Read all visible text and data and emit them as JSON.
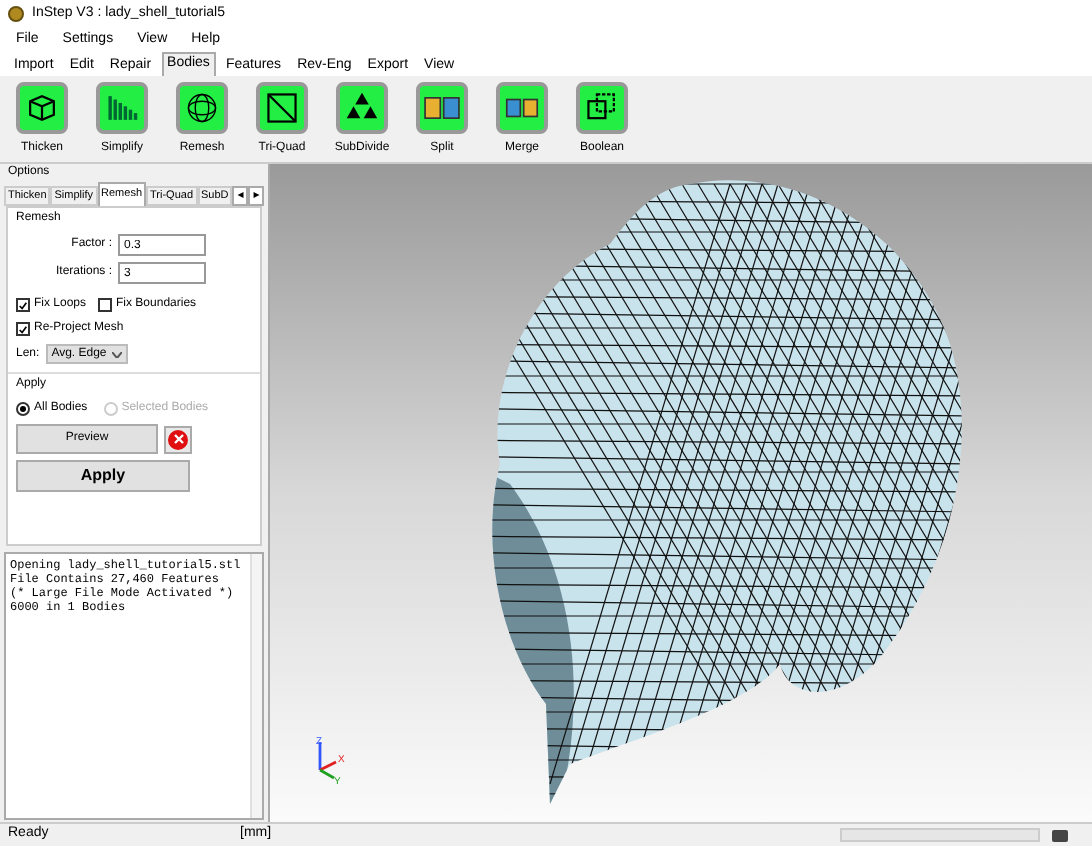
{
  "window": {
    "title": "InStep V3 : lady_shell_tutorial5"
  },
  "menu": [
    "File",
    "Settings",
    "View",
    "Help"
  ],
  "ribbon_tabs": [
    {
      "label": "Import",
      "selected": false
    },
    {
      "label": "Edit",
      "selected": false
    },
    {
      "label": "Repair",
      "selected": false
    },
    {
      "label": "Bodies",
      "selected": true
    },
    {
      "label": "Features",
      "selected": false
    },
    {
      "label": "Rev-Eng",
      "selected": false
    },
    {
      "label": "Export",
      "selected": false
    },
    {
      "label": "View",
      "selected": false
    }
  ],
  "tools": [
    {
      "label": "Thicken",
      "kind": "cube"
    },
    {
      "label": "Simplify",
      "kind": "bars"
    },
    {
      "label": "Remesh",
      "kind": "sphere"
    },
    {
      "label": "Tri-Quad",
      "kind": "square"
    },
    {
      "label": "SubDivide",
      "kind": "triangles"
    },
    {
      "label": "Split",
      "kind": "split"
    },
    {
      "label": "Merge",
      "kind": "merge"
    },
    {
      "label": "Boolean",
      "kind": "boolean"
    }
  ],
  "options": {
    "title": "Options",
    "tabs": [
      {
        "label": "Thicken",
        "selected": false
      },
      {
        "label": "Simplify",
        "selected": false
      },
      {
        "label": "Remesh",
        "selected": true
      },
      {
        "label": "Tri-Quad",
        "selected": false
      },
      {
        "label": "SubD",
        "selected": false
      }
    ],
    "scroll_left": "◂",
    "scroll_right": "▸",
    "remesh": {
      "title": "Remesh",
      "fields": [
        {
          "label": "Factor :",
          "value": "0.3"
        },
        {
          "label": "Iterations :",
          "value": "3"
        }
      ],
      "checkboxes": [
        {
          "label": "Fix Loops",
          "checked": true
        },
        {
          "label": "Fix Boundaries",
          "checked": false
        },
        {
          "label": "Re-Project Mesh",
          "checked": true
        }
      ],
      "len_label": "Len:",
      "len_value": "Avg. Edge"
    },
    "apply": {
      "title": "Apply",
      "radios": [
        {
          "label": "All Bodies",
          "selected": true,
          "disabled": false
        },
        {
          "label": "Selected Bodies",
          "selected": false,
          "disabled": true
        }
      ],
      "preview": "Preview",
      "apply": "Apply"
    }
  },
  "log": [
    "Opening lady_shell_tutorial5.stl",
    "File Contains 27,460 Features",
    "(* Large File Mode Activated *)",
    "6000 in 1 Bodies"
  ],
  "axes": [
    "Z",
    "X",
    "Y"
  ],
  "status_bar": {
    "text": "Ready",
    "units": "[mm]",
    "progress": {
      "level": 0
    }
  }
}
